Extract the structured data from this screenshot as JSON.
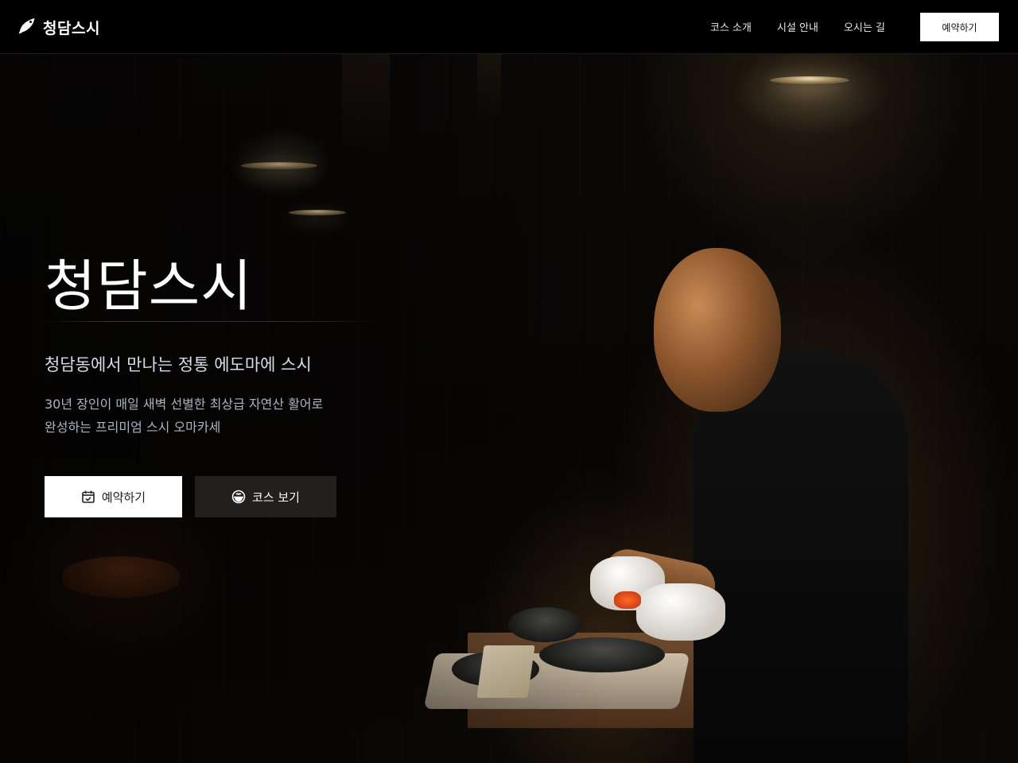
{
  "nav": {
    "brand": "청담스시",
    "brand_icon": "fish-icon",
    "links": [
      "코스 소개",
      "시설 안내",
      "오시는 길"
    ],
    "cta": "예약하기"
  },
  "hero": {
    "title": "청담스시",
    "subtitle": "청담동에서 만나는 정통 에도마에 스시",
    "description_lines": [
      "30년 장인이 매일 새벽 선별한 최상급 자연산 활어로",
      "완성하는 프리미엄 스시 오마카세"
    ],
    "buttons": {
      "reserve": {
        "label": "예약하기",
        "icon": "calendar-check-icon"
      },
      "course": {
        "label": "코스 보기",
        "icon": "bowl-icon"
      }
    }
  },
  "colors": {
    "nav_background": "#000000",
    "primary_button": "#ffffff",
    "secondary_button": "#282624",
    "subtitle_text": "#d8dde8",
    "description_text": "#a9b3c4"
  }
}
